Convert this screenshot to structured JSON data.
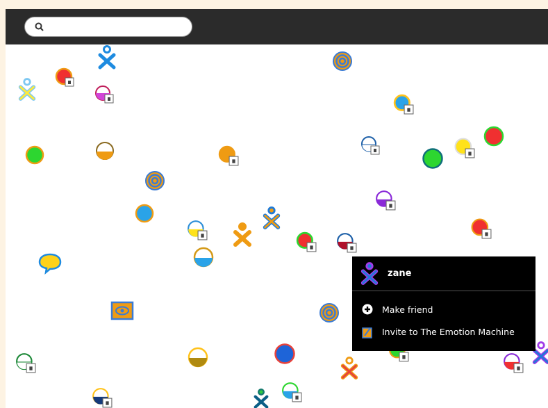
{
  "search": {
    "value": "",
    "placeholder": ""
  },
  "palette": {
    "buddy_name": "zane",
    "items": [
      {
        "label": "Make friend",
        "icon": "add-friend-icon"
      },
      {
        "label": "Invite to The Emotion Machine",
        "icon": "invite-activity-icon"
      }
    ]
  },
  "colors": {
    "toolbar": "#2b2b2b",
    "background": "#ffffff",
    "frame": "#fdf3e3",
    "palette": "#000000"
  }
}
